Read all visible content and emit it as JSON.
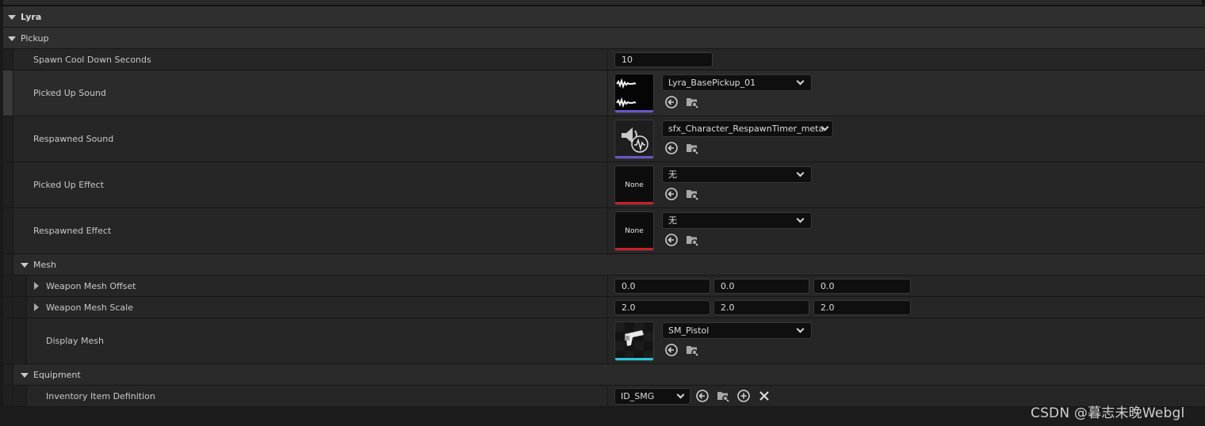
{
  "categories": {
    "lyra": "Lyra",
    "pickup": "Pickup",
    "mesh": "Mesh",
    "equipment": "Equipment"
  },
  "pickup": {
    "spawn_cooldown": {
      "label": "Spawn Cool Down Seconds",
      "value": "10"
    },
    "picked_up_sound": {
      "label": "Picked Up Sound",
      "asset": "Lyra_BasePickup_01",
      "bar_color": "#6a55c8"
    },
    "respawned_sound": {
      "label": "Respawned Sound",
      "asset": "sfx_Character_RespawnTimer_meta",
      "bar_color": "#6a55c8"
    },
    "picked_up_effect": {
      "label": "Picked Up Effect",
      "asset": "无",
      "thumb_text": "None",
      "bar_color": "#c8202a"
    },
    "respawned_effect": {
      "label": "Respawned Effect",
      "asset": "无",
      "thumb_text": "None",
      "bar_color": "#c8202a"
    }
  },
  "mesh": {
    "weapon_mesh_offset": {
      "label": "Weapon Mesh Offset",
      "x": "0.0",
      "y": "0.0",
      "z": "0.0"
    },
    "weapon_mesh_scale": {
      "label": "Weapon Mesh Scale",
      "x": "2.0",
      "y": "2.0",
      "z": "2.0"
    },
    "display_mesh": {
      "label": "Display Mesh",
      "asset": "SM_Pistol",
      "bar_color": "#2ac8d8"
    }
  },
  "equipment": {
    "inventory_item_definition": {
      "label": "Inventory Item Definition",
      "value": "ID_SMG"
    }
  },
  "watermark": "CSDN @暮志未晚Webgl",
  "colors": {
    "background": "#262626",
    "category": "#2f2f2f",
    "field": "#0f0f0f",
    "text": "#c8c8c8"
  }
}
